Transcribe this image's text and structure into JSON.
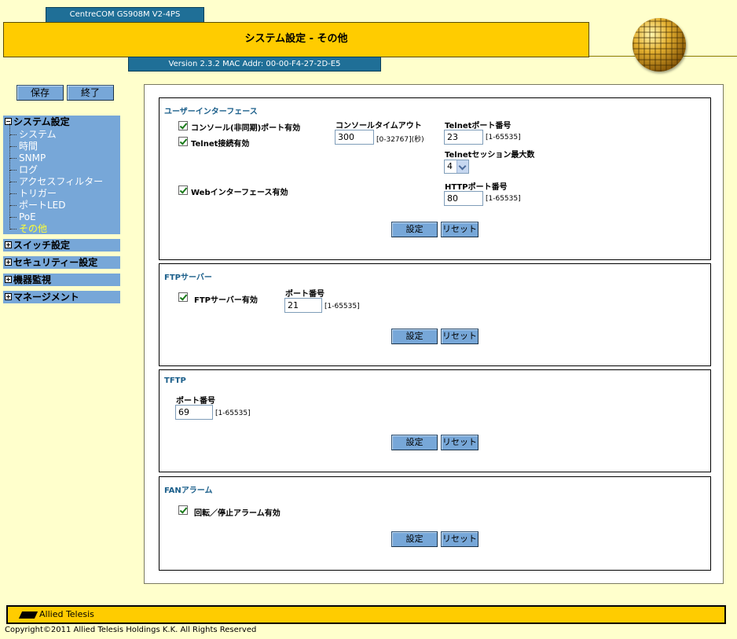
{
  "header": {
    "model": "CentreCOM GS908M V2-4PS",
    "title": "システム設定 - その他",
    "version": "Version 2.3.2 MAC Addr: 00-00-F4-27-2D-E5"
  },
  "top_buttons": {
    "save": "保存",
    "exit": "終了"
  },
  "sidebar": {
    "open_menu": {
      "label": "システム設定",
      "items": [
        "システム",
        "時間",
        "SNMP",
        "ログ",
        "アクセスフィルター",
        "トリガー",
        "ポートLED",
        "PoE",
        "その他"
      ],
      "active_index": 8
    },
    "closed_menus": [
      "スイッチ設定",
      "セキュリティー設定",
      "機器監視",
      "マネージメント"
    ]
  },
  "ui": {
    "title": "ユーザーインターフェース",
    "console_enable": "コンソール(非同期)ポート有効",
    "telnet_enable": "Telnet接続有効",
    "web_enable": "Webインターフェース有効",
    "console_timeout_label": "コンソールタイムアウト",
    "console_timeout_value": "300",
    "console_timeout_range": "[0-32767](秒)",
    "telnet_port_label": "Telnetポート番号",
    "telnet_port_value": "23",
    "telnet_port_range": "[1-65535]",
    "telnet_session_label": "Telnetセッション最大数",
    "telnet_session_value": "4",
    "http_port_label": "HTTPポート番号",
    "http_port_value": "80",
    "http_port_range": "[1-65535]",
    "set": "設定",
    "reset": "リセット"
  },
  "ftp": {
    "title": "FTPサーバー",
    "enable": "FTPサーバー有効",
    "port_label": "ポート番号",
    "port_value": "21",
    "port_range": "[1-65535]",
    "set": "設定",
    "reset": "リセット"
  },
  "tftp": {
    "title": "TFTP",
    "port_label": "ポート番号",
    "port_value": "69",
    "port_range": "[1-65535]",
    "set": "設定",
    "reset": "リセット"
  },
  "fan": {
    "title": "FANアラーム",
    "enable": "回転／停止アラーム有効",
    "set": "設定",
    "reset": "リセット"
  },
  "footer": {
    "logo": "Allied Telesis",
    "copyright": "Copyright©2011 Allied Telesis Holdings K.K. All Rights Reserved"
  },
  "colors": {
    "background": "#ffffcc",
    "title_bar": "#ffcc00",
    "tab_blue": "#1f6f97",
    "menu_blue": "#77a7d8",
    "active_item": "#ffff33",
    "section_title": "#1a5e8a"
  }
}
